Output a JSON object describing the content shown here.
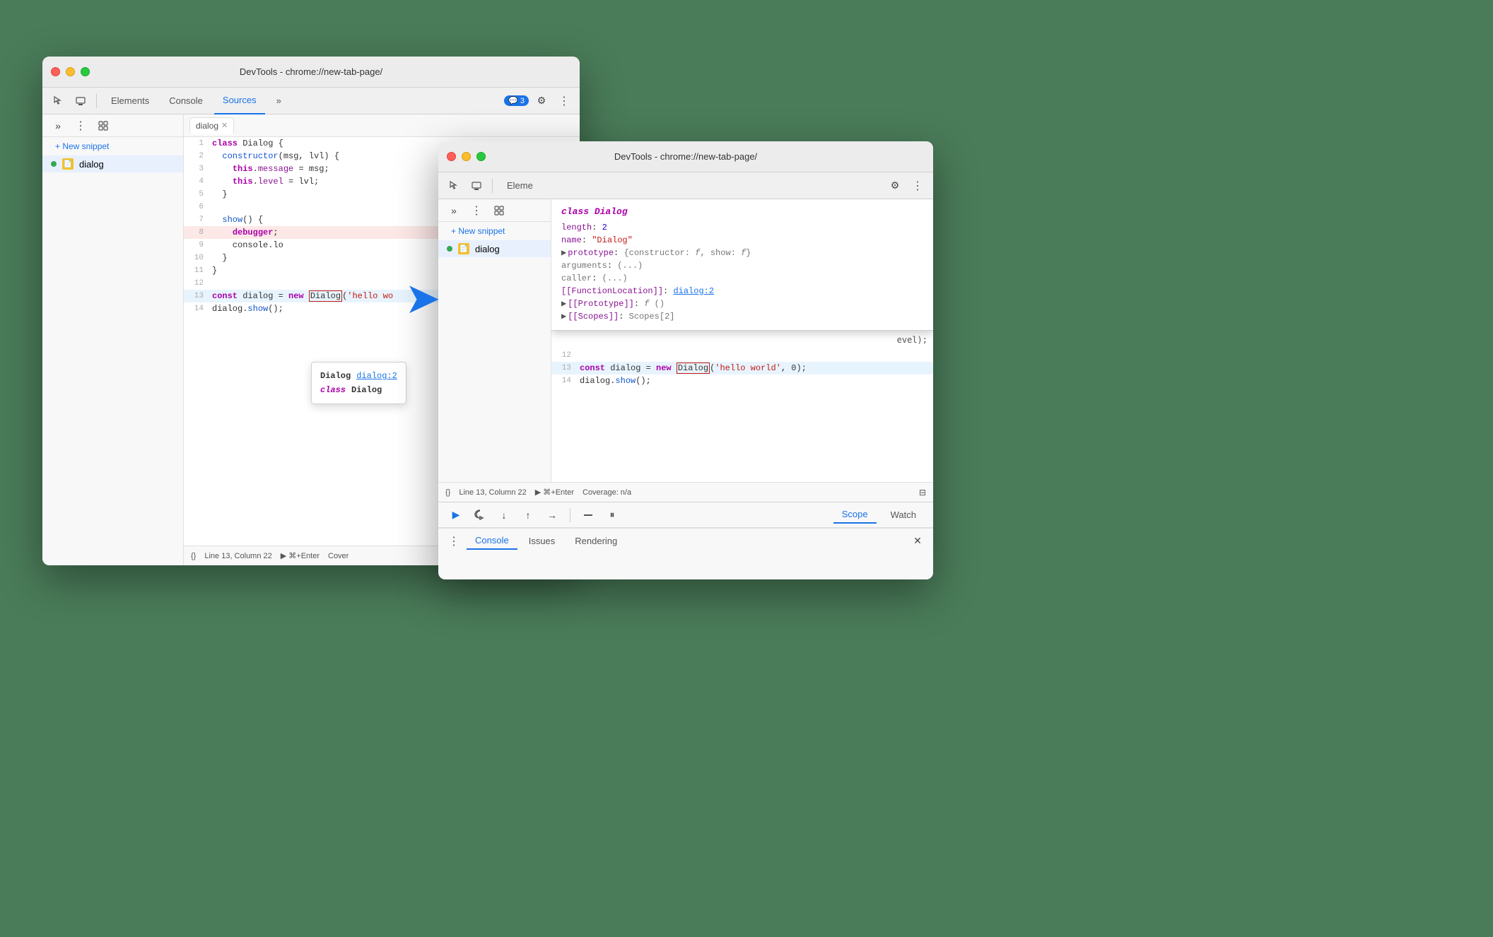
{
  "window1": {
    "title": "DevTools - chrome://new-tab-page/",
    "tabs": [
      "Elements",
      "Console",
      "Sources"
    ],
    "active_tab": "Sources",
    "badge": "3",
    "editor_tab": "dialog",
    "sidebar_item": "dialog",
    "snippet_btn": "+ New snippet",
    "code_lines": [
      {
        "num": 1,
        "text": "class Dialog {"
      },
      {
        "num": 2,
        "text": "  constructor(msg, lvl) {"
      },
      {
        "num": 3,
        "text": "    this.message = msg;"
      },
      {
        "num": 4,
        "text": "    this.level = lvl;"
      },
      {
        "num": 5,
        "text": "  }"
      },
      {
        "num": 6,
        "text": ""
      },
      {
        "num": 7,
        "text": "  show() {"
      },
      {
        "num": 8,
        "text": "    debugger;",
        "debug": true
      },
      {
        "num": 9,
        "text": "    console.lo"
      },
      {
        "num": 10,
        "text": "  }"
      },
      {
        "num": 11,
        "text": "}"
      },
      {
        "num": 12,
        "text": ""
      },
      {
        "num": 13,
        "text": "const dialog = new Dialog('hello wo"
      },
      {
        "num": 14,
        "text": "dialog.show();"
      }
    ],
    "status": {
      "line_col": "Line 13, Column 22",
      "run": "⌘+Enter",
      "coverage": "Cover"
    },
    "debug_tabs": [
      "Scope",
      "Watch"
    ],
    "bottom_tabs": [
      "Console",
      "Issues",
      "Rendering"
    ],
    "tooltip": {
      "line1_bold": "Dialog",
      "line1_link": "dialog:2",
      "line2_kw": "class",
      "line2_text": "Dialog"
    }
  },
  "window2": {
    "title": "DevTools - chrome://new-tab-page/",
    "tabs": [
      "Eleme"
    ],
    "sidebar_item": "dialog",
    "snippet_btn": "+ New snippet",
    "status": {
      "line_col": "Line 13, Column 22",
      "run": "⌘+Enter",
      "coverage": "Coverage: n/a"
    },
    "debug_tabs": [
      "Scope",
      "Watch"
    ],
    "bottom_tabs": [
      "Console",
      "Issues",
      "Rendering"
    ],
    "inspect_panel": {
      "title": "class Dialog",
      "rows": [
        {
          "key": "length",
          "val": "2",
          "type": "num"
        },
        {
          "key": "name",
          "val": "\"Dialog\"",
          "type": "str"
        },
        {
          "key": "prototype",
          "val": "{constructor: f, show: f}",
          "type": "expand"
        },
        {
          "key": "arguments",
          "val": "(...)",
          "type": "gray"
        },
        {
          "key": "caller",
          "val": "(...)",
          "type": "gray"
        },
        {
          "key": "[[FunctionLocation]]",
          "val": "dialog:2",
          "type": "link"
        },
        {
          "key": "[[Prototype]]",
          "val": "f ()",
          "type": "expand"
        },
        {
          "key": "[[Scopes]]",
          "val": "Scopes[2]",
          "type": "expand"
        }
      ]
    },
    "code_lines_bottom": [
      {
        "num": 12,
        "text": ""
      },
      {
        "num": 13,
        "text": "const dialog = new Dialog('hello world', 0);"
      },
      {
        "num": 14,
        "text": "dialog.show();"
      }
    ]
  },
  "labels": {
    "elements": "Elements",
    "console": "Console",
    "sources": "Sources",
    "more_tabs": "»",
    "new_snippet": "+ New snippet",
    "dialog": "dialog",
    "scope": "Scope",
    "watch": "Watch",
    "console_tab": "Console",
    "issues_tab": "Issues",
    "rendering_tab": "Rendering",
    "line_col_1": "Line 13, Column 22",
    "run_1": "▶ ⌘+Enter",
    "coverage_1": "Cover",
    "line_col_2": "Line 13, Column 22",
    "run_2": "▶ ⌘+Enter",
    "coverage_2": "Coverage: n/a"
  }
}
